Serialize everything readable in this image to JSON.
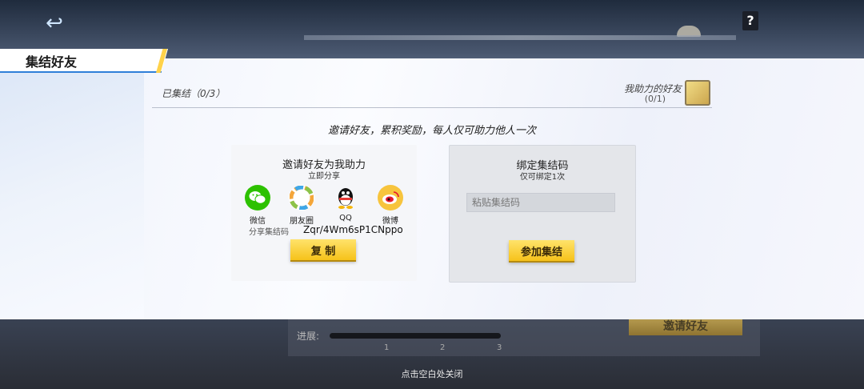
{
  "background": {
    "back_icon": "↩",
    "help_icon": "?",
    "progress_label": "进展:",
    "progress_steps": [
      "1",
      "2",
      "3"
    ],
    "invite_button": "邀请好友"
  },
  "dialog": {
    "title": "集结好友",
    "gathered_label": "已集结（0/3）",
    "helped_label": "我助力的好友",
    "helped_count": "(0/1)",
    "tagline": "邀请好友，累积奖励，每人仅可助力他人一次",
    "left_panel": {
      "title": "邀请好友为我助力",
      "subtitle": "立即分享",
      "share_options": [
        {
          "label": "微信",
          "icon": "wechat-icon",
          "color": "#2dc100"
        },
        {
          "label": "朋友圈",
          "icon": "moments-icon",
          "color": "#f4a63a"
        },
        {
          "label": "QQ",
          "icon": "qq-icon",
          "color": "#000000"
        },
        {
          "label": "微博",
          "icon": "weibo-icon",
          "color": "#e6162d"
        }
      ],
      "share_code_label": "分享集结码",
      "share_code": "Zqr/4Wm6sP1CNppo",
      "copy_button": "复 制"
    },
    "right_panel": {
      "title": "绑定集结码",
      "subtitle": "仅可绑定1次",
      "input_placeholder": "粘贴集结码",
      "join_button": "参加集结"
    }
  },
  "close_hint": "点击空白处关闭"
}
